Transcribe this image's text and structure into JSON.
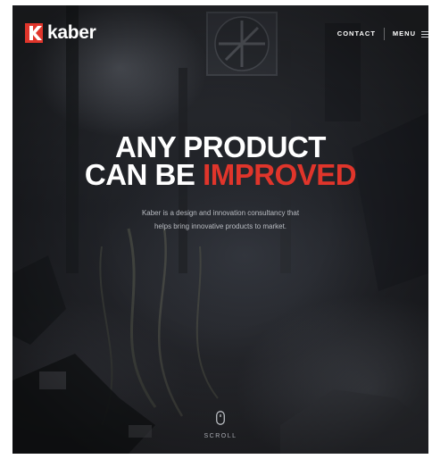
{
  "brand": {
    "name": "kaber",
    "accent_color": "#e0352b"
  },
  "nav": {
    "contact": "CONTACT",
    "menu": "MENU"
  },
  "hero": {
    "headline_line1": "ANY PRODUCT",
    "headline_line2_prefix": "CAN BE",
    "headline_line2_accent": "IMPROVED",
    "sub_line1": "Kaber is a design and innovation consultancy that",
    "sub_line2": "helps bring innovative products to market."
  },
  "scroll": {
    "label": "SCROLL"
  },
  "icons": [
    "kaber-logo-icon",
    "hamburger-icon",
    "mouse-scroll-icon"
  ]
}
